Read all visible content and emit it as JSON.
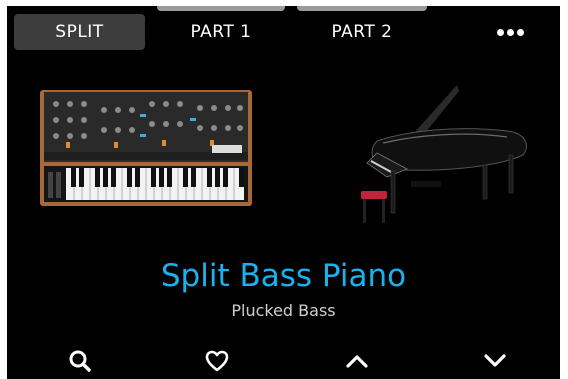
{
  "tabs": [
    {
      "label": "SPLIT",
      "active": true
    },
    {
      "label": "PART 1",
      "active": false
    },
    {
      "label": "PART 2",
      "active": false
    }
  ],
  "menu": {
    "icon": "more-dots-icon"
  },
  "preset": {
    "name": "Split Bass Piano",
    "subtitle": "Plucked Bass"
  },
  "instruments": [
    {
      "icon": "analog-synthesizer-image"
    },
    {
      "icon": "grand-piano-image"
    }
  ],
  "bottom_bar": {
    "search_icon": "search-icon",
    "favorite_icon": "heart-icon",
    "up_icon": "chevron-up-icon",
    "down_icon": "chevron-down-icon"
  },
  "colors": {
    "accent": "#1ab2ec",
    "background": "#000000",
    "tab_active": "#3d3d3d"
  }
}
